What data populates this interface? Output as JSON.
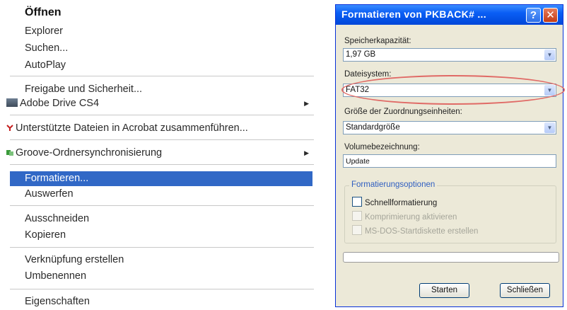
{
  "context_menu": {
    "open": "Öffnen",
    "explorer": "Explorer",
    "search": "Suchen...",
    "autoplay": "AutoPlay",
    "share": "Freigabe und Sicherheit...",
    "adobe_drive": "Adobe Drive CS4",
    "acrobat": "Unterstützte Dateien in Acrobat zusammenführen...",
    "groove": "Groove-Ordnersynchronisierung",
    "format": "Formatieren...",
    "eject": "Auswerfen",
    "cut": "Ausschneiden",
    "copy": "Kopieren",
    "create_shortcut": "Verknüpfung erstellen",
    "rename": "Umbenennen",
    "properties": "Eigenschaften",
    "submenu_arrow": "▶",
    "icons": {
      "adobe_drive": "adobe-drive-icon",
      "acrobat": "acrobat-icon",
      "groove": "groove-icon"
    }
  },
  "dialog": {
    "title": "Formatieren von PKBACK# ...",
    "help_glyph": "?",
    "close_glyph": "✕",
    "capacity_label": "Speicherkapazität:",
    "capacity_value": "1,97 GB",
    "filesystem_label": "Dateisystem:",
    "filesystem_value": "FAT32",
    "alloc_label": "Größe der Zuordnungseinheiten:",
    "alloc_value": "Standardgröße",
    "volume_label": "Volumebezeichnung:",
    "volume_value": "Update",
    "options_title": "Formatierungsoptionen",
    "quick_format": "Schnellformatierung",
    "compression": "Komprimierung aktivieren",
    "msdos": "MS-DOS-Startdiskette erstellen",
    "progress": 0,
    "start_button": "Starten",
    "close_button": "Schließen",
    "dropdown_glyph": "▼"
  },
  "colors": {
    "selection": "#3168c6",
    "annotation_ellipse": "#e06a66",
    "titlebar": "#0a5ef5"
  }
}
